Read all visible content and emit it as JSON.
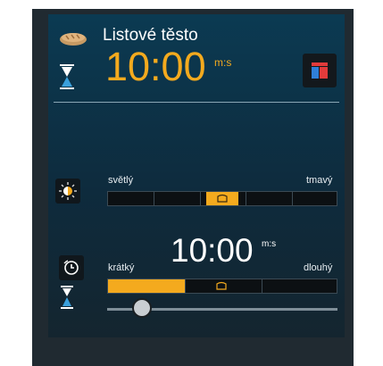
{
  "program": {
    "name": "Listové těsto",
    "time": "10:00",
    "time_unit": "m:s",
    "menu_icon": "menu-grid-icon"
  },
  "browning": {
    "icon": "browning-level-icon",
    "label_light": "světlý",
    "label_dark": "tmavý",
    "level": 0.5
  },
  "duration": {
    "icon": "timer-icon",
    "time": "10:00",
    "time_unit": "m:s",
    "label_short": "krátký",
    "label_long": "dlouhý",
    "slider_fraction": 0.15
  },
  "colors": {
    "accent": "#f4aa1e",
    "screen_top": "#0b3a52",
    "screen_bottom": "#14252f"
  }
}
